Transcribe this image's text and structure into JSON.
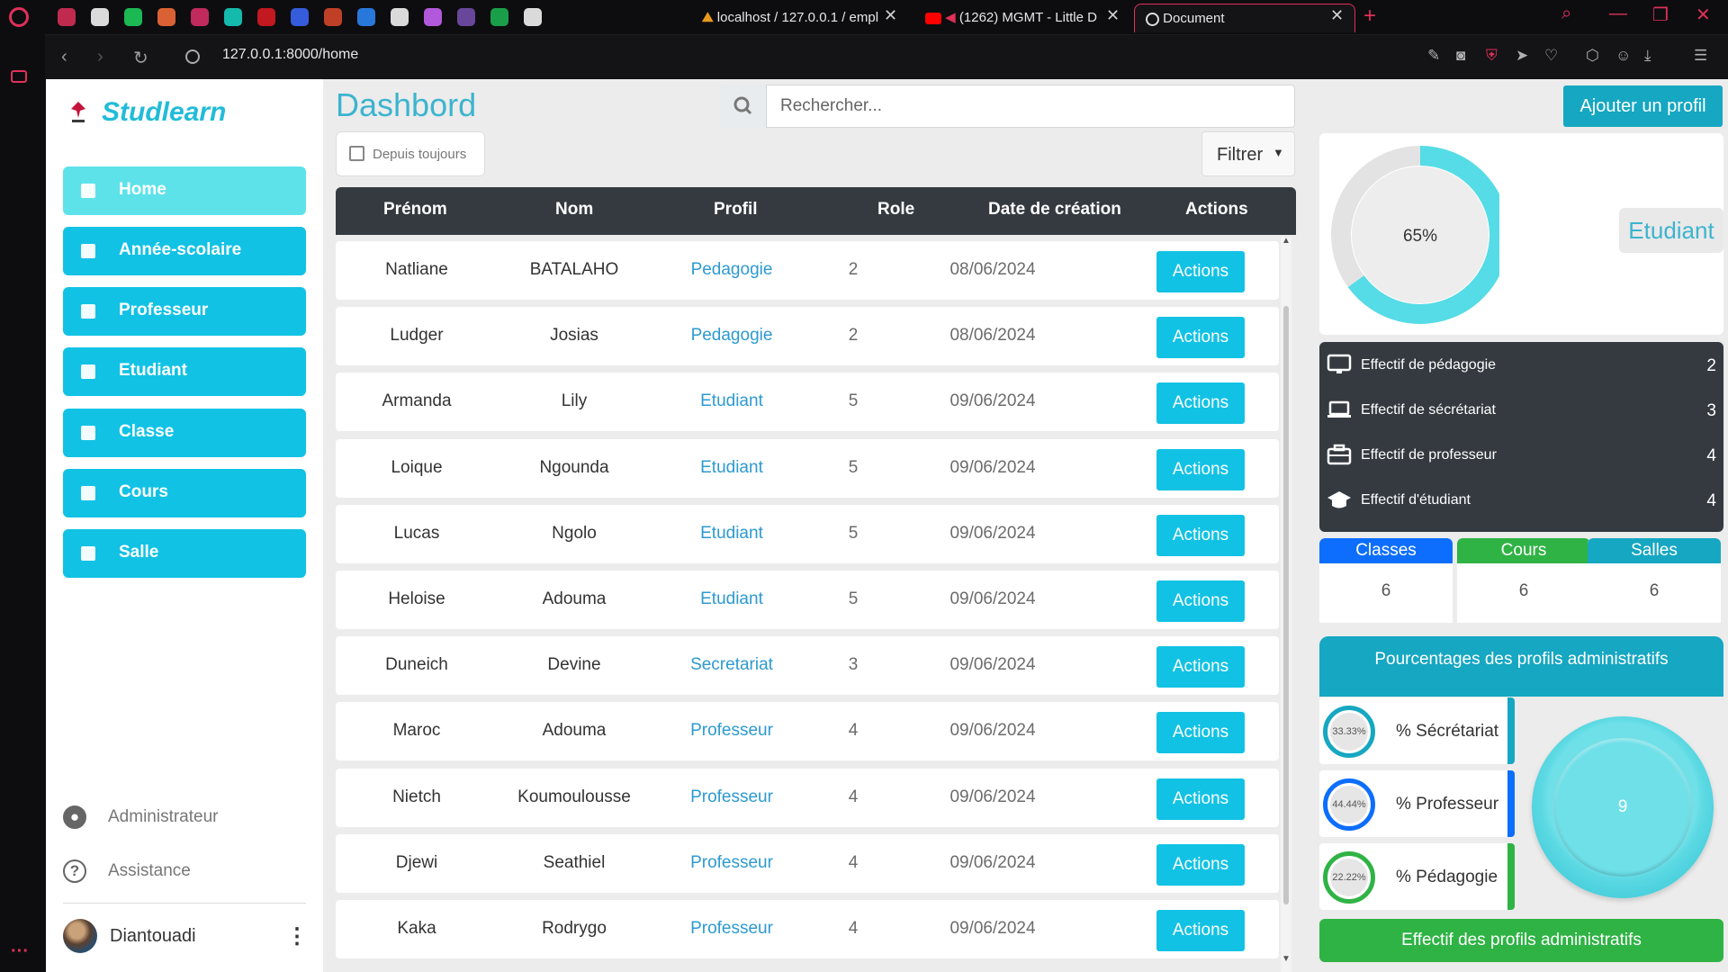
{
  "browser": {
    "tabs": [
      {
        "title": "localhost / 127.0.0.1 / empl",
        "active": false
      },
      {
        "title": "(1262) MGMT - Little D",
        "active": false
      },
      {
        "title": "Document",
        "active": true
      }
    ],
    "url": "127.0.0.1:8000/home",
    "icons": [
      "opera-icon",
      "gamepad-icon",
      "tiktok-icon",
      "spotify-icon",
      "firefox-icon",
      "folder-icon",
      "play-icon",
      "flag-icon",
      "blue-square-icon",
      "bottle-icon",
      "wallet-icon",
      "github-icon",
      "orb-icon",
      "bootstrap-icon",
      "w-icon",
      "chatgpt-icon"
    ]
  },
  "app": {
    "brand": "Studlearn",
    "nav": [
      {
        "label": "Home",
        "icon": "bar-chart-icon",
        "active": true
      },
      {
        "label": "Année-scolaire",
        "icon": "calendar-icon",
        "active": false
      },
      {
        "label": "Professeur",
        "icon": "briefcase-icon",
        "active": false
      },
      {
        "label": "Etudiant",
        "icon": "graduation-cap-icon",
        "active": false
      },
      {
        "label": "Classe",
        "icon": "door-icon",
        "active": false
      },
      {
        "label": "Cours",
        "icon": "book-icon",
        "active": false
      },
      {
        "label": "Salle",
        "icon": "store-icon",
        "active": false
      }
    ],
    "footer": {
      "admin_label": "Administrateur",
      "help_label": "Assistance",
      "help_glyph": "?",
      "username": "Diantouadi"
    }
  },
  "main": {
    "title": "Dashbord",
    "search_placeholder": "Rechercher...",
    "date_filter": "Depuis toujours",
    "filter_label": "Filtrer",
    "add_profile": "Ajouter un profil",
    "columns": [
      "Prénom",
      "Nom",
      "Profil",
      "Role",
      "Date de création",
      "Actions"
    ],
    "rows": [
      {
        "prenom": "Natliane",
        "nom": "BATALAHO",
        "profil": "Pedagogie",
        "role": "2",
        "date": "08/06/2024",
        "action": "Actions"
      },
      {
        "prenom": "Ludger",
        "nom": "Josias",
        "profil": "Pedagogie",
        "role": "2",
        "date": "08/06/2024",
        "action": "Actions"
      },
      {
        "prenom": "Armanda",
        "nom": "Lily",
        "profil": "Etudiant",
        "role": "5",
        "date": "09/06/2024",
        "action": "Actions"
      },
      {
        "prenom": "Loique",
        "nom": "Ngounda",
        "profil": "Etudiant",
        "role": "5",
        "date": "09/06/2024",
        "action": "Actions"
      },
      {
        "prenom": "Lucas",
        "nom": "Ngolo",
        "profil": "Etudiant",
        "role": "5",
        "date": "09/06/2024",
        "action": "Actions"
      },
      {
        "prenom": "Heloise",
        "nom": "Adouma",
        "profil": "Etudiant",
        "role": "5",
        "date": "09/06/2024",
        "action": "Actions"
      },
      {
        "prenom": "Duneich",
        "nom": "Devine",
        "profil": "Secretariat",
        "role": "3",
        "date": "09/06/2024",
        "action": "Actions"
      },
      {
        "prenom": "Maroc",
        "nom": "Adouma",
        "profil": "Professeur",
        "role": "4",
        "date": "09/06/2024",
        "action": "Actions"
      },
      {
        "prenom": "Nietch",
        "nom": "Koumoulousse",
        "profil": "Professeur",
        "role": "4",
        "date": "09/06/2024",
        "action": "Actions"
      },
      {
        "prenom": "Djewi",
        "nom": "Seathiel",
        "profil": "Professeur",
        "role": "4",
        "date": "09/06/2024",
        "action": "Actions"
      },
      {
        "prenom": "Kaka",
        "nom": "Rodrygo",
        "profil": "Professeur",
        "role": "4",
        "date": "09/06/2024",
        "action": "Actions"
      }
    ]
  },
  "right": {
    "donut_percent": 65,
    "donut_label": "65%",
    "donut_category": "Etudiant",
    "stats": [
      {
        "label": "Effectif de pédagogie",
        "value": "2",
        "icon": "monitor-icon"
      },
      {
        "label": "Effectif de sécrétariat",
        "value": "3",
        "icon": "laptop-icon"
      },
      {
        "label": "Effectif de professeur",
        "value": "4",
        "icon": "briefcase-icon"
      },
      {
        "label": "Effectif d'étudiant",
        "value": "4",
        "icon": "graduation-cap-icon"
      }
    ],
    "minicards": [
      {
        "label": "Classes",
        "value": "6",
        "color": "#0d6efd"
      },
      {
        "label": "Cours",
        "value": "6",
        "color": "#2fb345"
      },
      {
        "label": "Salles",
        "value": "6",
        "color": "#16a7c2"
      }
    ],
    "pct_title": "Pourcentages des profils administratifs",
    "pct_rows": [
      {
        "label": "% Sécrétariat",
        "pct": "33.33%",
        "color": "#16a7c2"
      },
      {
        "label": "% Professeur",
        "pct": "44.44%",
        "color": "#0d6efd"
      },
      {
        "label": "% Pédagogie",
        "pct": "22.22%",
        "color": "#2fb345"
      }
    ],
    "total": "9",
    "footer_label": "Effectif des profils administratifs"
  },
  "colors": {
    "accent": "#12c2e4",
    "active_nav": "#5de2ea",
    "title": "#3cb4cf",
    "dark": "#343a40",
    "browser_accent": "#e0305a"
  }
}
